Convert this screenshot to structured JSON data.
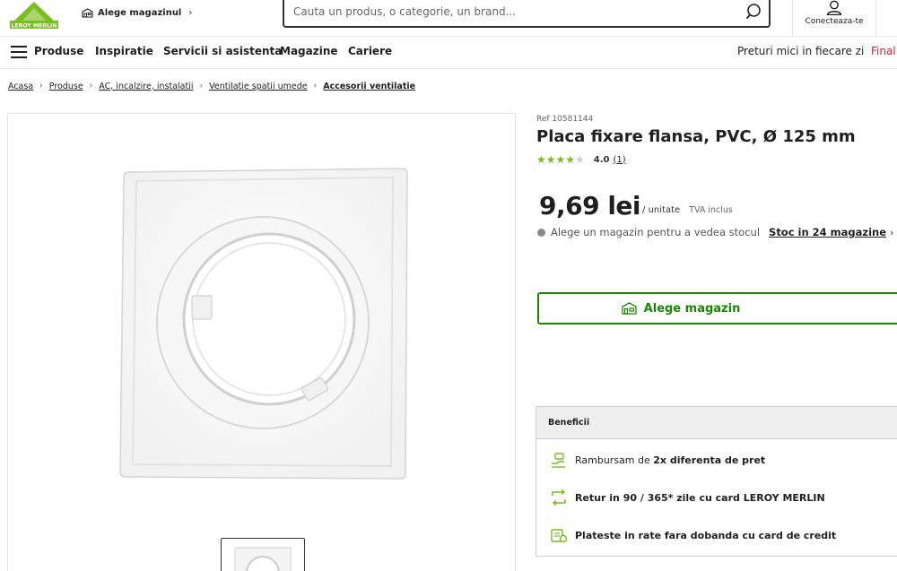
{
  "header": {
    "logo_text": "LEROY MERLIN",
    "store_link": "Alege magazinul",
    "search_placeholder": "Cauta un produs, o categorie, un brand...",
    "account_label": "Conecteaza-te"
  },
  "nav": {
    "menu_label": "Produse",
    "items": [
      "Inspiratie",
      "Servicii si asistenta",
      "Magazine",
      "Cariere"
    ],
    "right_items": [
      "Preturi mici in fiecare zi",
      "Final"
    ]
  },
  "breadcrumb": [
    "Acasa",
    "Produse",
    "AC, incalzire, instalatii",
    "Ventilatie spatii umede",
    "Accesorii ventilatie"
  ],
  "product": {
    "ref": "Ref 10581144",
    "title": "Placa fixare flansa, PVC, Ø 125 mm",
    "rating_score": "4.0",
    "rating_count": "(1)",
    "rating_stars": 4,
    "price": "9,69 lei",
    "unit": "/ unitate",
    "tva": "TVA inclus",
    "stock_text": "Alege un magazin pentru a vedea stocul",
    "stock_link": "Stoc in 24 magazine",
    "choose_store_button": "Alege magazin"
  },
  "benefits": {
    "title": "Beneficii",
    "items": [
      {
        "prefix": "Rambursam de ",
        "bold": "2x diferenta de pret",
        "suffix": ""
      },
      {
        "prefix": "",
        "bold": "Retur in 90 / 365* zile cu card LEROY MERLIN",
        "suffix": ""
      },
      {
        "prefix": "",
        "bold": "Plateste in rate fara dobanda cu card de credit",
        "suffix": ""
      }
    ]
  },
  "colors": {
    "brand_green": "#78be20",
    "button_green": "#188803",
    "promo_red": "#c9242b"
  }
}
